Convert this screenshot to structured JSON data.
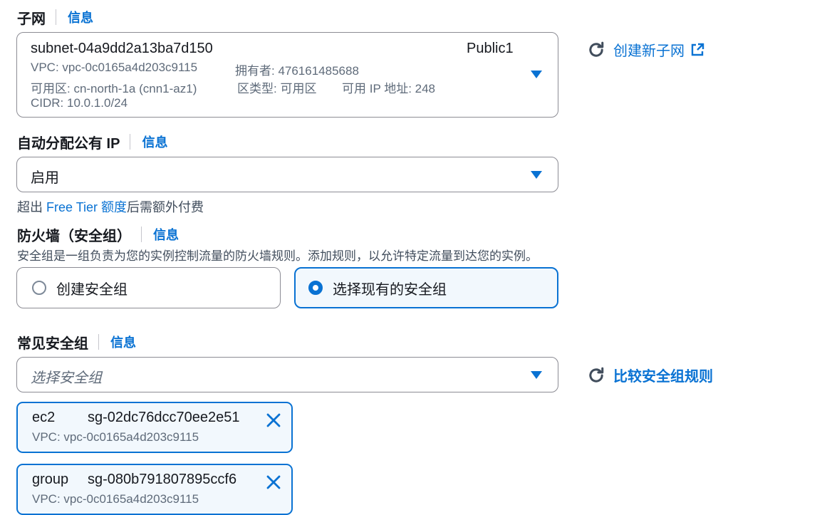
{
  "subnet": {
    "label": "子网",
    "info": "信息",
    "subnet_id": "subnet-04a9dd2a13ba7d150",
    "subnet_name": "Public1",
    "vpc": "VPC: vpc-0c0165a4d203c9115",
    "owner": "拥有者: 476161485688",
    "az": "可用区: cn-north-1a (cnn1-az1)",
    "zone_type": "区类型: 可用区",
    "available_ip": "可用 IP 地址: 248",
    "cidr": "CIDR: 10.0.1.0/24",
    "create_link": "创建新子网"
  },
  "public_ip": {
    "label": "自动分配公有 IP",
    "info": "信息",
    "value": "启用",
    "note_prefix": "超出 ",
    "note_link": "Free Tier 额度",
    "note_suffix": "后需额外付费"
  },
  "firewall": {
    "label": "防火墙（安全组）",
    "info": "信息",
    "description": "安全组是一组负责为您的实例控制流量的防火墙规则。添加规则，以允许特定流量到达您的实例。",
    "option_create": "创建安全组",
    "option_select": "选择现有的安全组",
    "selected": "select"
  },
  "common_sg": {
    "label": "常见安全组",
    "info": "信息",
    "placeholder": "选择安全组",
    "compare_link": "比较安全组规则",
    "tokens": [
      {
        "name": "ec2",
        "id": "sg-02dc76dcc70ee2e51",
        "vpc": "VPC: vpc-0c0165a4d203c9115"
      },
      {
        "name": "group",
        "id": "sg-080b791807895ccf6",
        "vpc": "VPC: vpc-0c0165a4d203c9115"
      }
    ]
  },
  "colors": {
    "accent": "#0972d3",
    "text": "#16191f",
    "secondary_text": "#5f6b7a",
    "border": "#8c8c94",
    "selected_bg": "#f2f8fd"
  }
}
